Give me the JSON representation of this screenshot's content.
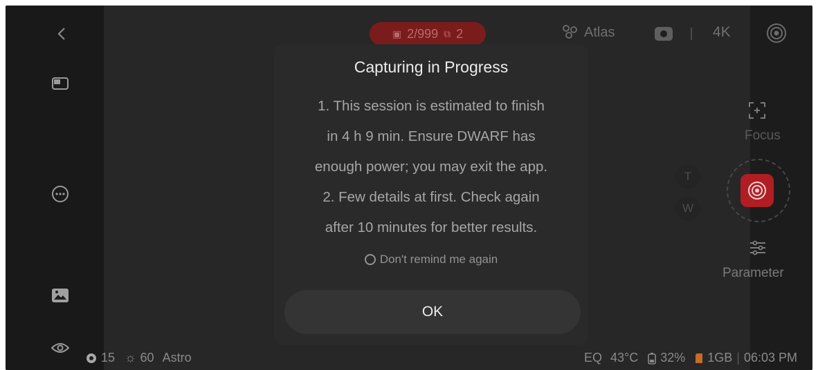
{
  "header": {
    "counter": "2/999",
    "stack_count": "2",
    "atlas_label": "Atlas",
    "resolution": "4K"
  },
  "right_panel": {
    "focus_label": "Focus",
    "parameter_label": "Parameter",
    "zoom_tele": "T",
    "zoom_wide": "W"
  },
  "dialog": {
    "title": "Capturing in Progress",
    "lines": [
      "1. This session is estimated to finish",
      "in 4 h 9 min. Ensure DWARF has",
      "enough power; you may exit the app.",
      "2. Few details at first. Check again",
      "after 10 minutes for better results."
    ],
    "remind_label": "Don't remind me again",
    "ok_label": "OK"
  },
  "status": {
    "exposure": "15",
    "gain": "60",
    "mode": "Astro",
    "eq": "EQ",
    "temperature": "43°C",
    "battery": "32%",
    "storage": "1GB",
    "time": "06:03 PM"
  },
  "colors": {
    "accent_red": "#b01e24",
    "background": "#1f1f1f",
    "dialog": "#2a2a2a"
  },
  "icons": [
    "back-icon",
    "layout-icon",
    "more-icon",
    "gallery-icon",
    "eye-icon",
    "atlas-icon",
    "camera-switch-icon",
    "target-icon",
    "focus-icon",
    "parameter-icon",
    "shutter-icon"
  ]
}
